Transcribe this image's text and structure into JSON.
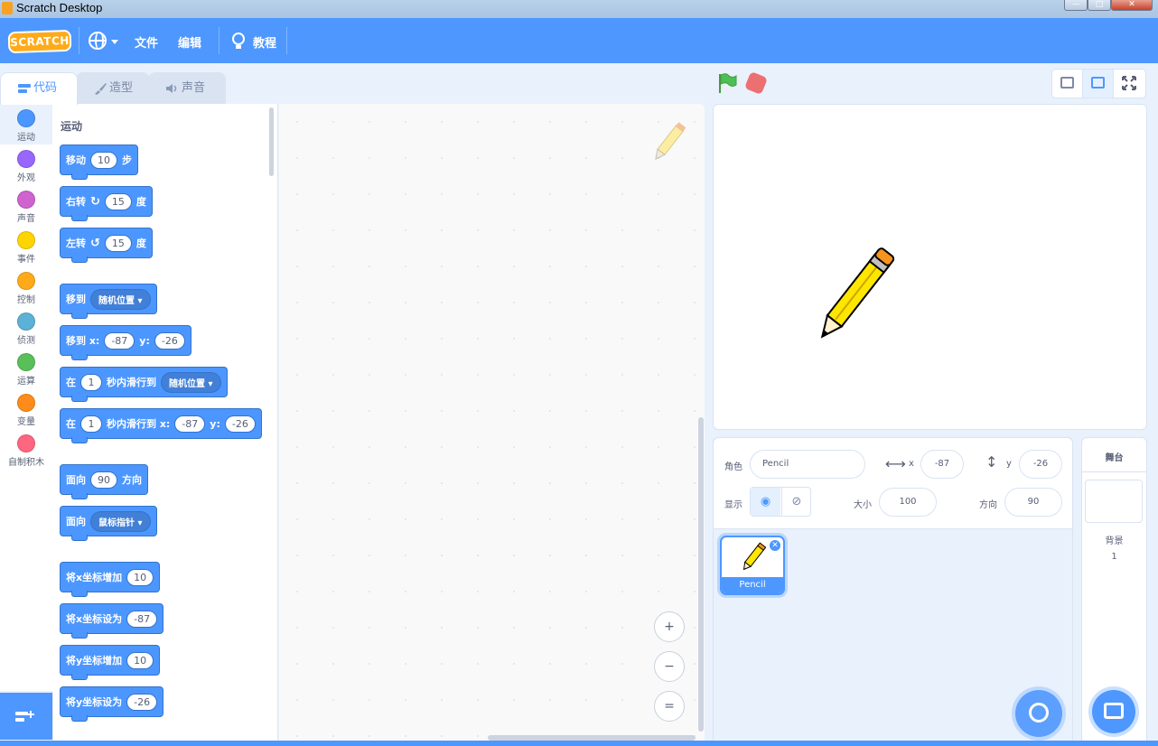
{
  "window": {
    "title": "Scratch Desktop"
  },
  "menubar": {
    "logo": "SCRATCH",
    "file": "文件",
    "edit": "编辑",
    "tutorials": "教程"
  },
  "tabs": [
    {
      "label": "代码",
      "icon": "code-icon"
    },
    {
      "label": "造型",
      "icon": "brush-icon"
    },
    {
      "label": "声音",
      "icon": "speaker-icon"
    }
  ],
  "categories": [
    {
      "label": "运动",
      "color": "#4c97ff"
    },
    {
      "label": "外观",
      "color": "#9966ff"
    },
    {
      "label": "声音",
      "color": "#cf63cf"
    },
    {
      "label": "事件",
      "color": "#ffd500"
    },
    {
      "label": "控制",
      "color": "#ffab19"
    },
    {
      "label": "侦测",
      "color": "#5cb1d6"
    },
    {
      "label": "运算",
      "color": "#59c059"
    },
    {
      "label": "变量",
      "color": "#ff8c1a"
    },
    {
      "label": "自制积木",
      "color": "#ff6680"
    }
  ],
  "palette": {
    "title": "运动",
    "blocks": {
      "move": {
        "a": "移动",
        "v": "10",
        "b": "步"
      },
      "turn_right": {
        "a": "右转",
        "v": "15",
        "b": "度"
      },
      "turn_left": {
        "a": "左转",
        "v": "15",
        "b": "度"
      },
      "goto": {
        "a": "移到",
        "menu": "随机位置"
      },
      "goto_xy": {
        "a": "移到 x:",
        "x": "-87",
        "b": "y:",
        "y": "-26"
      },
      "glide_to": {
        "a": "在",
        "v": "1",
        "b": "秒内滑行到",
        "menu": "随机位置"
      },
      "glide_xy": {
        "a": "在",
        "v": "1",
        "b": "秒内滑行到 x:",
        "x": "-87",
        "c": "y:",
        "y": "-26"
      },
      "point_dir": {
        "a": "面向",
        "v": "90",
        "b": "方向"
      },
      "point_towards": {
        "a": "面向",
        "menu": "鼠标指针"
      },
      "change_x": {
        "a": "将x坐标增加",
        "v": "10"
      },
      "set_x": {
        "a": "将x坐标设为",
        "v": "-87"
      },
      "change_y": {
        "a": "将y坐标增加",
        "v": "10"
      },
      "set_y": {
        "a": "将y坐标设为",
        "v": "-26"
      }
    }
  },
  "zoom": {
    "in": "+",
    "out": "−",
    "reset": "="
  },
  "sprite_info": {
    "sprite_label": "角色",
    "sprite_name": "Pencil",
    "x_label": "x",
    "x": "-87",
    "y_label": "y",
    "y": "-26",
    "show_label": "显示",
    "size_label": "大小",
    "size": "100",
    "direction_label": "方向",
    "direction": "90"
  },
  "sprites": [
    {
      "name": "Pencil"
    }
  ],
  "stage_target": {
    "title": "舞台",
    "backdrops_label": "背景",
    "backdrops_count": "1"
  }
}
